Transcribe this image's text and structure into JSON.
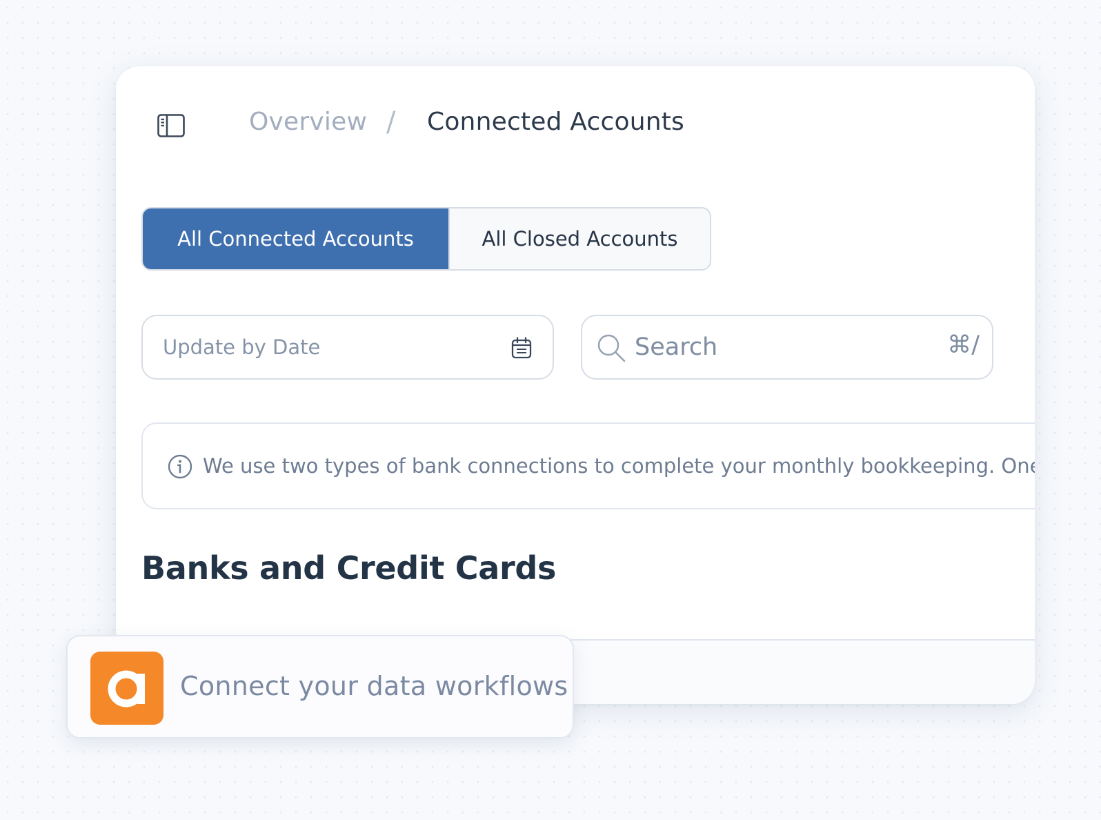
{
  "breadcrumb": {
    "sidebar_toggle_icon": "sidebar-panel-icon",
    "home": "Overview",
    "separator": "/",
    "current": "Connected Accounts"
  },
  "tabs": {
    "items": [
      {
        "label": "All Connected Accounts",
        "active": true
      },
      {
        "label": "All Closed Accounts",
        "active": false
      }
    ],
    "active_color": "#3e6fae"
  },
  "filters": {
    "date_label": "Update by Date",
    "date_icon": "calendar-icon",
    "search_placeholder": "Search",
    "search_icon": "search-icon",
    "search_shortcut": "⌘/"
  },
  "info": {
    "icon": "info-icon",
    "message": "We use two types of bank connections to complete your monthly bookkeeping. One o"
  },
  "section": {
    "title": "Banks and Credit Cards"
  },
  "promo": {
    "logo_letter": "a",
    "logo_color": "#f5892a",
    "text": "Connect your data workflows"
  }
}
